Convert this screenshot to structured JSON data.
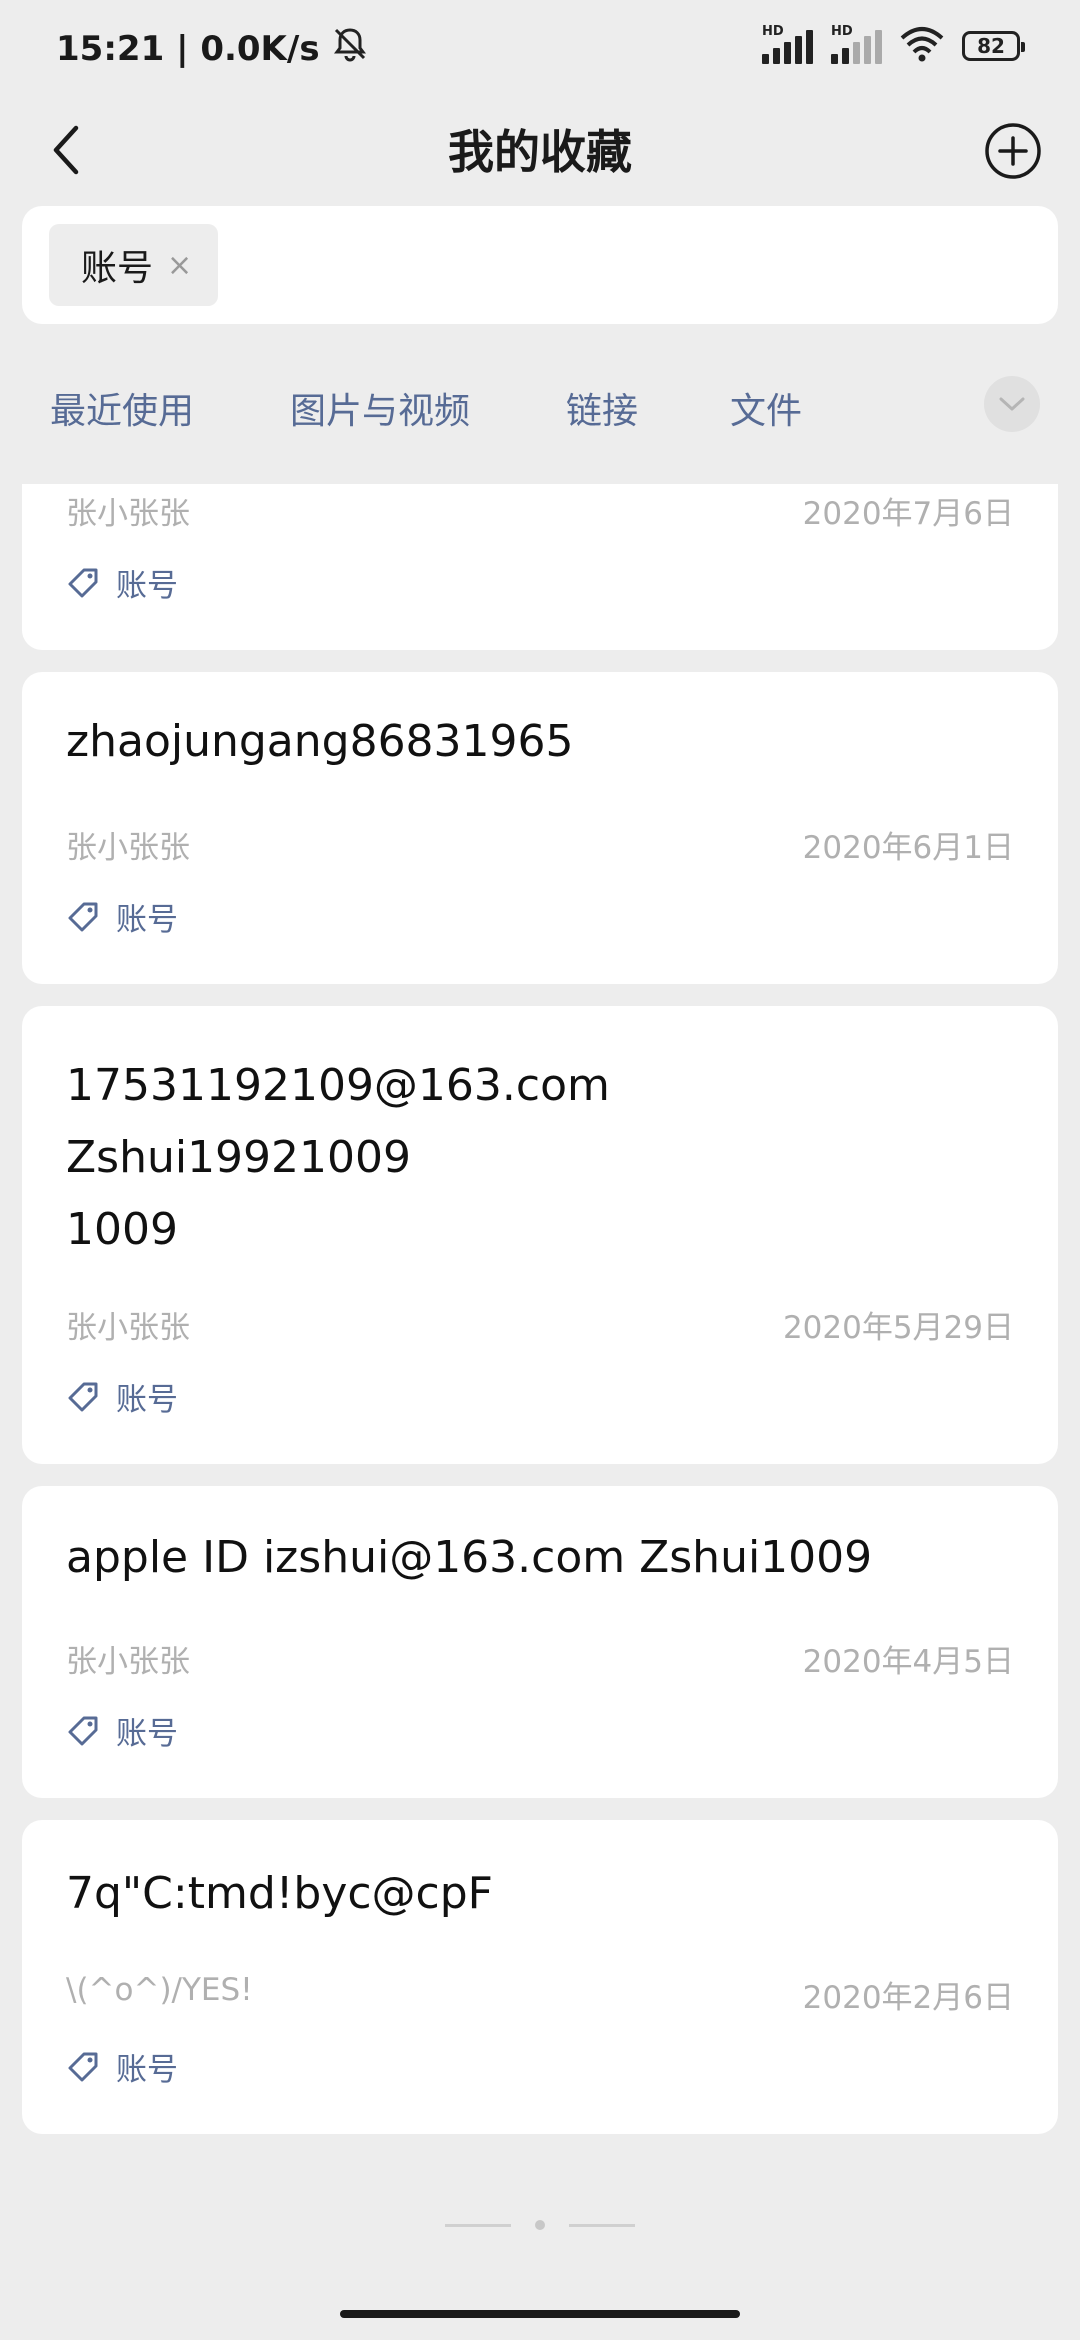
{
  "status_bar": {
    "time_speed": "15:21 | 0.0K/s",
    "hd_label": "HD",
    "battery": "82"
  },
  "nav": {
    "title": "我的收藏"
  },
  "search": {
    "chip_label": "账号",
    "chip_close": "×"
  },
  "tabs": [
    {
      "label": "最近使用"
    },
    {
      "label": "图片与视频"
    },
    {
      "label": "链接"
    },
    {
      "label": "文件"
    }
  ],
  "items": [
    {
      "content": "",
      "author": "张小张张",
      "date": "2020年7月6日",
      "tag": "账号"
    },
    {
      "content": "zhaojungang86831965",
      "author": "张小张张",
      "date": "2020年6月1日",
      "tag": "账号"
    },
    {
      "content": "17531192109@163.com\nZshui19921009\n1009",
      "author": "张小张张",
      "date": "2020年5月29日",
      "tag": "账号"
    },
    {
      "content": "apple ID izshui@163.com Zshui1009",
      "author": "张小张张",
      "date": "2020年4月5日",
      "tag": "账号"
    },
    {
      "content": "7q\"C:tmd!byc@cpF",
      "author": "\\(^o^)/YES!",
      "date": "2020年2月6日",
      "tag": "账号"
    }
  ]
}
